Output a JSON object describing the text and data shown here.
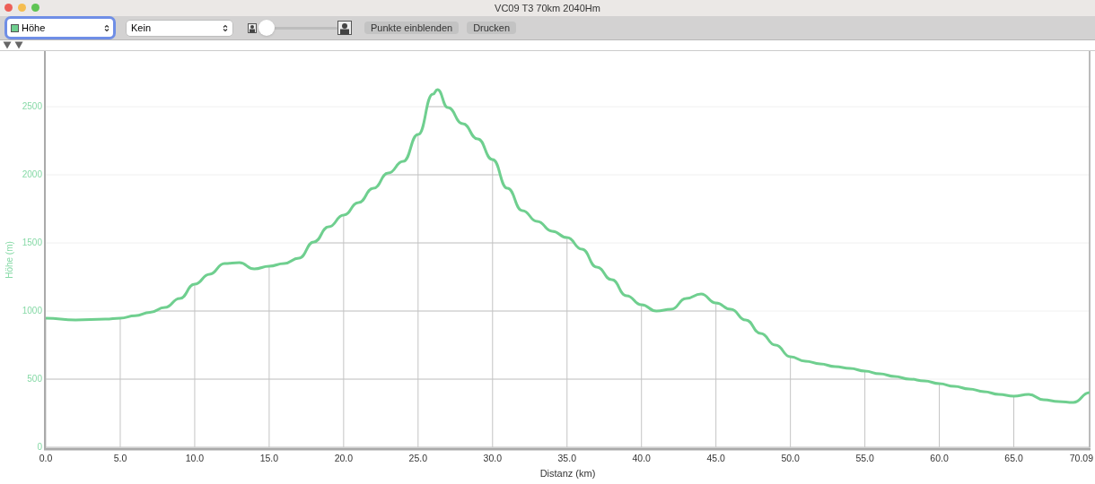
{
  "window": {
    "title": "VC09 T3 70km 2040Hm"
  },
  "toolbar": {
    "profile_select": {
      "value": "Höhe",
      "color": "#6fcf8f",
      "focused": true
    },
    "overlay_select": {
      "value": "Kein",
      "focused": false
    },
    "zoom_slider": {
      "level": 0.1
    },
    "buttons": [
      "Punkte einblenden",
      "Drucken"
    ]
  },
  "markers": [
    {
      "kind": "triangle"
    },
    {
      "kind": "triangle"
    }
  ],
  "chart": {
    "chart_data": {
      "type": "line",
      "xlabel": "Distanz (km)",
      "ylabel": "Höhe (m)",
      "x": [
        0,
        2,
        4,
        5,
        6,
        7,
        8,
        9,
        10,
        11,
        12,
        13,
        14,
        15,
        16,
        17,
        18,
        19,
        20,
        21,
        22,
        23,
        24,
        25,
        26,
        26.3,
        27,
        28,
        29,
        30,
        31,
        32,
        33,
        34,
        35,
        36,
        37,
        38,
        39,
        40,
        41,
        42,
        43,
        44,
        45,
        46,
        47,
        48,
        49,
        50,
        51,
        52,
        53,
        54,
        55,
        56,
        57,
        58,
        59,
        60,
        61,
        62,
        63,
        64,
        65,
        66,
        67,
        68,
        69,
        70.09
      ],
      "series": [
        {
          "color": "#6fcf8f",
          "values": [
            947,
            935,
            940,
            947,
            965,
            990,
            1026,
            1092,
            1197,
            1270,
            1349,
            1355,
            1309,
            1329,
            1349,
            1388,
            1507,
            1618,
            1704,
            1796,
            1901,
            2013,
            2099,
            2296,
            2592,
            2625,
            2493,
            2375,
            2263,
            2112,
            1901,
            1737,
            1658,
            1586,
            1539,
            1454,
            1322,
            1230,
            1112,
            1046,
            1000,
            1013,
            1092,
            1125,
            1059,
            1013,
            934,
            836,
            750,
            664,
            632,
            612,
            592,
            579,
            559,
            539,
            520,
            500,
            487,
            467,
            447,
            428,
            408,
            388,
            375,
            388,
            349,
            336,
            329,
            401
          ]
        }
      ],
      "grid": true,
      "xlim": [
        0,
        70.09
      ],
      "ylim": [
        0,
        2900
      ],
      "xticks": [
        {
          "value": 0,
          "label": "0.0"
        },
        {
          "value": 5,
          "label": "5.0"
        },
        {
          "value": 10,
          "label": "10.0"
        },
        {
          "value": 15,
          "label": "15.0"
        },
        {
          "value": 20,
          "label": "20.0"
        },
        {
          "value": 25,
          "label": "25.0"
        },
        {
          "value": 30,
          "label": "30.0"
        },
        {
          "value": 35,
          "label": "35.0"
        },
        {
          "value": 40,
          "label": "40.0"
        },
        {
          "value": 45,
          "label": "45.0"
        },
        {
          "value": 50,
          "label": "50.0"
        },
        {
          "value": 55,
          "label": "55.0"
        },
        {
          "value": 60,
          "label": "60.0"
        },
        {
          "value": 65,
          "label": "65.0"
        },
        {
          "value": 70.09,
          "label": "70.09"
        }
      ],
      "yticks": [
        0,
        500,
        1000,
        1500,
        2000,
        2500
      ]
    }
  }
}
